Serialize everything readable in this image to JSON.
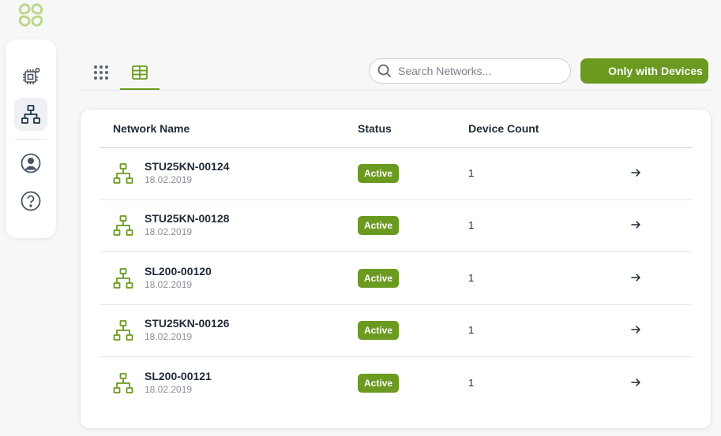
{
  "brand": {
    "accent": "#6a9a1f",
    "logo_icon": "clover-logo-icon"
  },
  "sidebar": {
    "items": [
      {
        "icon": "chip-icon",
        "active": false
      },
      {
        "icon": "network-icon",
        "active": true
      },
      {
        "icon": "user-circle-icon",
        "active": false
      },
      {
        "icon": "help-circle-icon",
        "active": false
      }
    ]
  },
  "toolbar": {
    "view_grid_icon": "dots-grid-icon",
    "view_table_icon": "table-icon",
    "active_view": "table",
    "search_placeholder": "Search Networks...",
    "only_devices_label": "Only with Devices"
  },
  "table": {
    "columns": [
      "Network Name",
      "Status",
      "Device Count"
    ],
    "rows": [
      {
        "name": "STU25KN-00124",
        "date": "18.02.2019",
        "status": "Active",
        "count": "1"
      },
      {
        "name": "STU25KN-00128",
        "date": "18.02.2019",
        "status": "Active",
        "count": "1"
      },
      {
        "name": "SL200-00120",
        "date": "18.02.2019",
        "status": "Active",
        "count": "1"
      },
      {
        "name": "STU25KN-00126",
        "date": "18.02.2019",
        "status": "Active",
        "count": "1"
      },
      {
        "name": "SL200-00121",
        "date": "18.02.2019",
        "status": "Active",
        "count": "1"
      }
    ]
  }
}
